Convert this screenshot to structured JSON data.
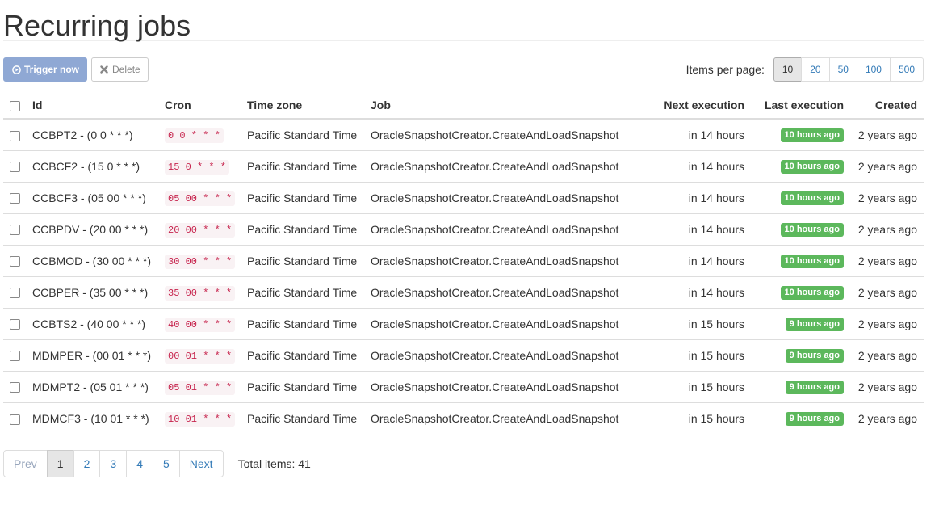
{
  "page": {
    "title": "Recurring jobs"
  },
  "toolbar": {
    "trigger_label": "Trigger now",
    "delete_label": "Delete",
    "items_per_page_label": "Items per page:",
    "page_sizes": [
      "10",
      "20",
      "50",
      "100",
      "500"
    ],
    "selected_page_size": "10"
  },
  "table": {
    "headers": {
      "id": "Id",
      "cron": "Cron",
      "timezone": "Time zone",
      "job": "Job",
      "next": "Next execution",
      "last": "Last execution",
      "created": "Created"
    },
    "rows": [
      {
        "id": "CCBPT2 - (0 0 * * *)",
        "cron": "0 0 * * *",
        "timezone": "Pacific Standard Time",
        "job": "OracleSnapshotCreator.CreateAndLoadSnapshot",
        "next": "in 14 hours",
        "last": "10 hours ago",
        "created": "2 years ago"
      },
      {
        "id": "CCBCF2 - (15 0 * * *)",
        "cron": "15 0 * * *",
        "timezone": "Pacific Standard Time",
        "job": "OracleSnapshotCreator.CreateAndLoadSnapshot",
        "next": "in 14 hours",
        "last": "10 hours ago",
        "created": "2 years ago"
      },
      {
        "id": "CCBCF3 - (05 00 * * *)",
        "cron": "05 00 * * *",
        "timezone": "Pacific Standard Time",
        "job": "OracleSnapshotCreator.CreateAndLoadSnapshot",
        "next": "in 14 hours",
        "last": "10 hours ago",
        "created": "2 years ago"
      },
      {
        "id": "CCBPDV - (20 00 * * *)",
        "cron": "20 00 * * *",
        "timezone": "Pacific Standard Time",
        "job": "OracleSnapshotCreator.CreateAndLoadSnapshot",
        "next": "in 14 hours",
        "last": "10 hours ago",
        "created": "2 years ago"
      },
      {
        "id": "CCBMOD - (30 00 * * *)",
        "cron": "30 00 * * *",
        "timezone": "Pacific Standard Time",
        "job": "OracleSnapshotCreator.CreateAndLoadSnapshot",
        "next": "in 14 hours",
        "last": "10 hours ago",
        "created": "2 years ago"
      },
      {
        "id": "CCBPER - (35 00 * * *)",
        "cron": "35 00 * * *",
        "timezone": "Pacific Standard Time",
        "job": "OracleSnapshotCreator.CreateAndLoadSnapshot",
        "next": "in 14 hours",
        "last": "10 hours ago",
        "created": "2 years ago"
      },
      {
        "id": "CCBTS2 - (40 00 * * *)",
        "cron": "40 00 * * *",
        "timezone": "Pacific Standard Time",
        "job": "OracleSnapshotCreator.CreateAndLoadSnapshot",
        "next": "in 15 hours",
        "last": "9 hours ago",
        "created": "2 years ago"
      },
      {
        "id": "MDMPER - (00 01 * * *)",
        "cron": "00 01 * * *",
        "timezone": "Pacific Standard Time",
        "job": "OracleSnapshotCreator.CreateAndLoadSnapshot",
        "next": "in 15 hours",
        "last": "9 hours ago",
        "created": "2 years ago"
      },
      {
        "id": "MDMPT2 - (05 01 * * *)",
        "cron": "05 01 * * *",
        "timezone": "Pacific Standard Time",
        "job": "OracleSnapshotCreator.CreateAndLoadSnapshot",
        "next": "in 15 hours",
        "last": "9 hours ago",
        "created": "2 years ago"
      },
      {
        "id": "MDMCF3 - (10 01 * * *)",
        "cron": "10 01 * * *",
        "timezone": "Pacific Standard Time",
        "job": "OracleSnapshotCreator.CreateAndLoadSnapshot",
        "next": "in 15 hours",
        "last": "9 hours ago",
        "created": "2 years ago"
      }
    ]
  },
  "pagination": {
    "prev_label": "Prev",
    "pages": [
      "1",
      "2",
      "3",
      "4",
      "5"
    ],
    "active_page": "1",
    "next_label": "Next",
    "total_label": "Total items: 41"
  },
  "colors": {
    "primary_button": "#8fa8d4",
    "success_label": "#5cb85c",
    "link": "#337ab7",
    "cron_text": "#c7254e"
  },
  "icons": {
    "trigger": "play-circle-icon",
    "delete": "close-icon"
  }
}
